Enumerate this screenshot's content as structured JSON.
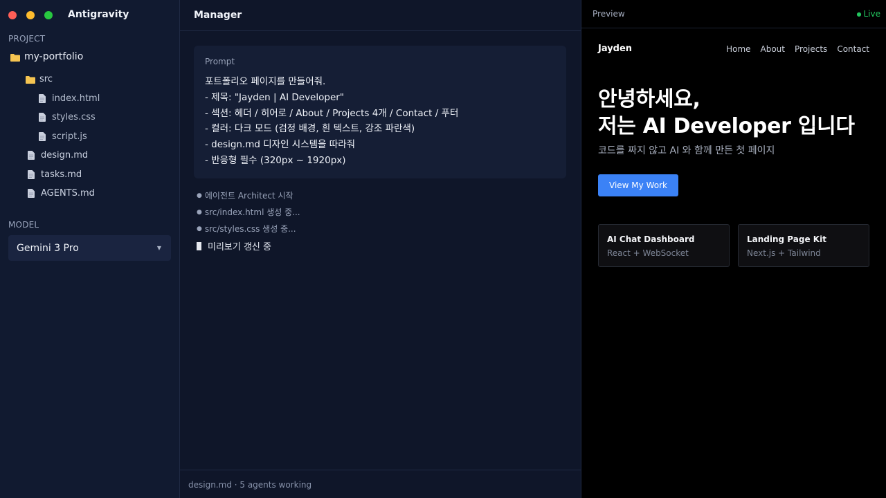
{
  "window": {
    "app_title": "Antigravity",
    "controls": [
      "close",
      "minimize",
      "maximize"
    ]
  },
  "sidebar": {
    "project_label": "PROJECT",
    "tree": {
      "root": "my-portfolio",
      "folder": "src",
      "src_files": [
        "index.html",
        "styles.css",
        "script.js"
      ],
      "files": [
        "design.md",
        "tasks.md",
        "AGENTS.md"
      ]
    },
    "model_label": "MODEL",
    "model_value": "Gemini 3 Pro"
  },
  "manager": {
    "title": "Manager",
    "prompt": {
      "label": "Prompt",
      "lines": [
        "포트폴리오 페이지를 만들어줘.",
        "- 제목: \"Jayden | AI Developer\"",
        "- 섹션: 헤더 / 히어로 / About / Projects 4개 / Contact / 푸터",
        "- 컬러: 다크 모드 (검정 배경, 흰 텍스트, 강조 파란색)",
        "- design.md 디자인 시스템을 따라줘",
        "- 반응형 필수 (320px ~ 1920px)"
      ]
    },
    "log": [
      "에이전트 Architect 시작",
      "src/index.html 생성 중...",
      "src/styles.css 생성 중..."
    ],
    "active_log": "미리보기 갱신 중",
    "footer": "design.md · 5 agents working"
  },
  "preview": {
    "title": "Preview",
    "status": "Live",
    "site": {
      "logo": "Jayden",
      "nav": [
        "Home",
        "About",
        "Projects",
        "Contact"
      ],
      "hero_line1": "안녕하세요,",
      "hero_line2": "저는 AI Developer 입니다",
      "subtitle": "코드를 짜지 않고 AI 와 함께 만든 첫 페이지",
      "cta": "View My Work",
      "projects": [
        {
          "title": "AI Chat Dashboard",
          "meta": "React + WebSocket"
        },
        {
          "title": "Landing Page Kit",
          "meta": "Next.js + Tailwind"
        }
      ]
    }
  },
  "colors": {
    "accent": "#3b82f6",
    "live": "#22c55e",
    "folder": "#f5c451"
  }
}
